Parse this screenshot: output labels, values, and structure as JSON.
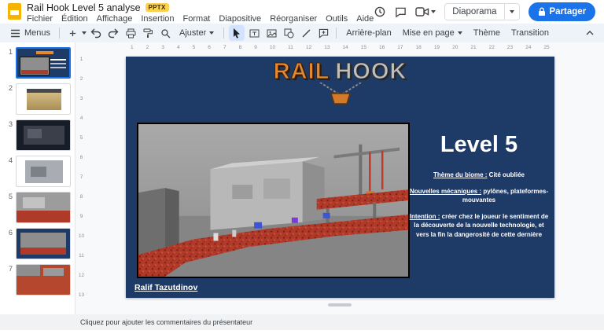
{
  "header": {
    "title": "Rail Hook Level 5 analyse",
    "badge": "PPTX",
    "menus": [
      "Fichier",
      "Édition",
      "Affichage",
      "Insertion",
      "Format",
      "Diapositive",
      "Réorganiser",
      "Outils",
      "Aide"
    ],
    "diaporama": "Diaporama",
    "share": "Partager"
  },
  "toolbar": {
    "menus": "Menus",
    "zoom_fit": "Ajuster",
    "background": "Arrière-plan",
    "layout": "Mise en page",
    "theme": "Thème",
    "transition": "Transition"
  },
  "filmstrip": {
    "slides": [
      "1",
      "2",
      "3",
      "4",
      "5",
      "6",
      "7"
    ]
  },
  "ruler": {
    "horizontal": [
      "1",
      "2",
      "3",
      "4",
      "5",
      "6",
      "7",
      "8",
      "9",
      "10",
      "11",
      "12",
      "13",
      "14",
      "15",
      "16",
      "17",
      "18",
      "19",
      "20",
      "21",
      "22",
      "23",
      "24",
      "25"
    ],
    "vertical": [
      "1",
      "2",
      "3",
      "4",
      "5",
      "6",
      "7",
      "8",
      "9",
      "10",
      "11",
      "12",
      "13"
    ]
  },
  "slide": {
    "logo": {
      "rail": "RAIL",
      "hook": "HOOK"
    },
    "title": "Level 5",
    "bullets": [
      {
        "label": "Thème du biome :",
        "text": " Cité oubliée"
      },
      {
        "label": "Nouvelles mécaniques :",
        "text": " pylônes, plateformes-mouvantes"
      },
      {
        "label": "Intention :",
        "text": " créer chez le joueur le sentiment de la découverte de la nouvelle technologie, et vers la fin la dangerosité de cette dernière"
      }
    ],
    "author": "Ralif Tazutdinov"
  },
  "notes": {
    "placeholder": "Cliquez pour ajouter les commentaires du présentateur"
  },
  "colors": {
    "accent": "#1a73e8",
    "share_bg": "#1a73e8",
    "slide_bg": "#1e3a66",
    "lava": "#b03a2a",
    "logo_orange": "#e8882d",
    "logo_gray": "#bfbfbf"
  }
}
